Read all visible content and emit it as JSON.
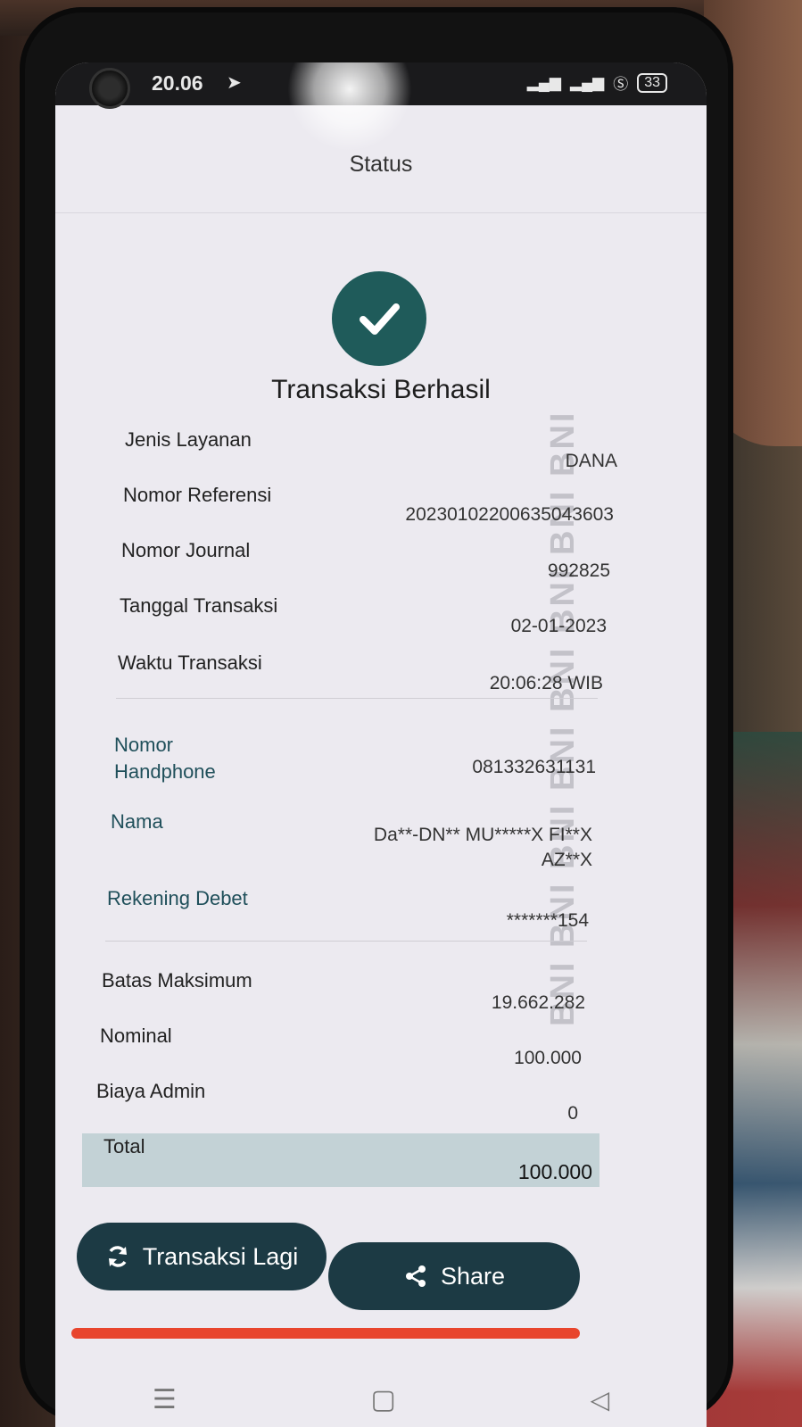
{
  "statusbar": {
    "time": "20.06",
    "battery": "33"
  },
  "header": {
    "title": "Status"
  },
  "result": {
    "title": "Transaksi Berhasil"
  },
  "details": [
    {
      "label": "Jenis Layanan",
      "value": "DANA"
    },
    {
      "label": "Nomor Referensi",
      "value": "20230102200635043603"
    },
    {
      "label": "Nomor Journal",
      "value": "992825"
    },
    {
      "label": "Tanggal Transaksi",
      "value": "02-01-2023"
    },
    {
      "label": "Waktu Transaksi",
      "value": "20:06:28 WIB"
    }
  ],
  "customer": [
    {
      "label": "Nomor Handphone",
      "value": "081332631131"
    },
    {
      "label": "Nama",
      "value": "Da**-DN** MU*****X FI**X AZ**X"
    },
    {
      "label": "Rekening Debet",
      "value": "*******154"
    }
  ],
  "amounts": [
    {
      "label": "Batas Maksimum",
      "value": "19.662.282"
    },
    {
      "label": "Nominal",
      "value": "100.000"
    },
    {
      "label": "Biaya Admin",
      "value": "0"
    }
  ],
  "total": {
    "label": "Total",
    "value": "100.000"
  },
  "watermark": "BNI BNI BNI BNI BNI BNI BNI BNI",
  "buttons": {
    "repeat": "Transaksi Lagi",
    "share": "Share"
  },
  "colors": {
    "accent": "#1f5b5a",
    "button": "#1c3a44",
    "total_bg": "#c3d2d6",
    "brand_bar": "#e8452d"
  }
}
